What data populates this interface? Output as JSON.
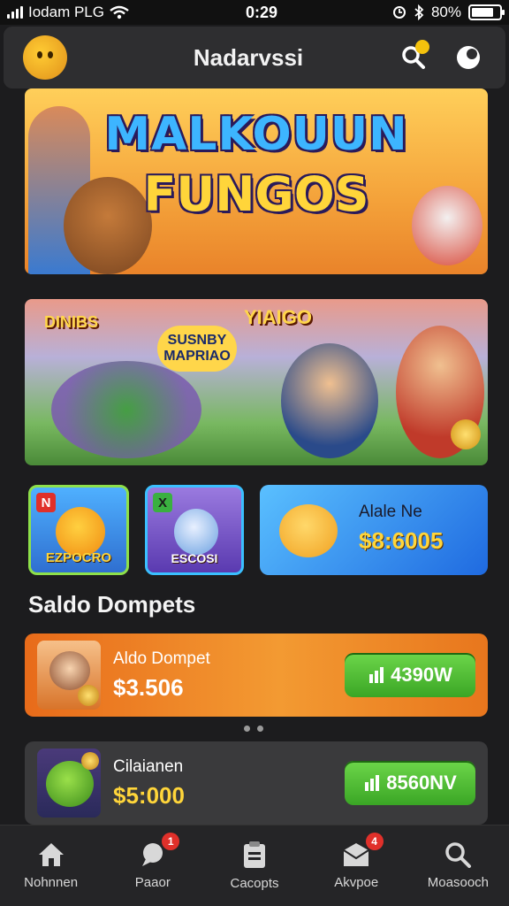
{
  "status_bar": {
    "carrier": "Iodam PLG",
    "time": "0:29",
    "battery": "80%",
    "battery_level": 0.8
  },
  "header": {
    "title": "Nadarvssi",
    "search_icon": "search-icon",
    "profile_icon": "profile-icon"
  },
  "banners": [
    {
      "title_line1": "MALKOUUN",
      "title_line2": "FUNGOS"
    },
    {
      "tag1": "SUSNBY MAPRIAO",
      "tag2": "YIAIGO",
      "tag3": "DINIBS"
    }
  ],
  "tiles": [
    {
      "corner": "N",
      "label": "EZPOCRO"
    },
    {
      "corner": "X",
      "label": "ESCOSI"
    },
    {
      "title": "Alale Ne",
      "amount": "$8:6005"
    }
  ],
  "section": {
    "title": "Saldo Dompets"
  },
  "wallets": [
    {
      "name": "Aldo Dompet",
      "amount": "$3.506",
      "button": "4390W"
    },
    {
      "name": "Cilaianen",
      "amount": "$5:000",
      "button": "8560NV"
    }
  ],
  "nav": [
    {
      "label": "Nohnnen",
      "icon": "home-icon",
      "badge": ""
    },
    {
      "label": "Paaor",
      "icon": "chat-icon",
      "badge": "1"
    },
    {
      "label": "Cacopts",
      "icon": "clipboard-icon",
      "badge": ""
    },
    {
      "label": "Akvpoe",
      "icon": "mail-icon",
      "badge": "4"
    },
    {
      "label": "Moasooch",
      "icon": "search-icon",
      "badge": ""
    }
  ],
  "colors": {
    "background": "#1c1c1e",
    "accent_green": "#3aa625",
    "accent_orange": "#e8761d",
    "accent_yellow": "#ffd53a",
    "badge_red": "#e0302a"
  }
}
